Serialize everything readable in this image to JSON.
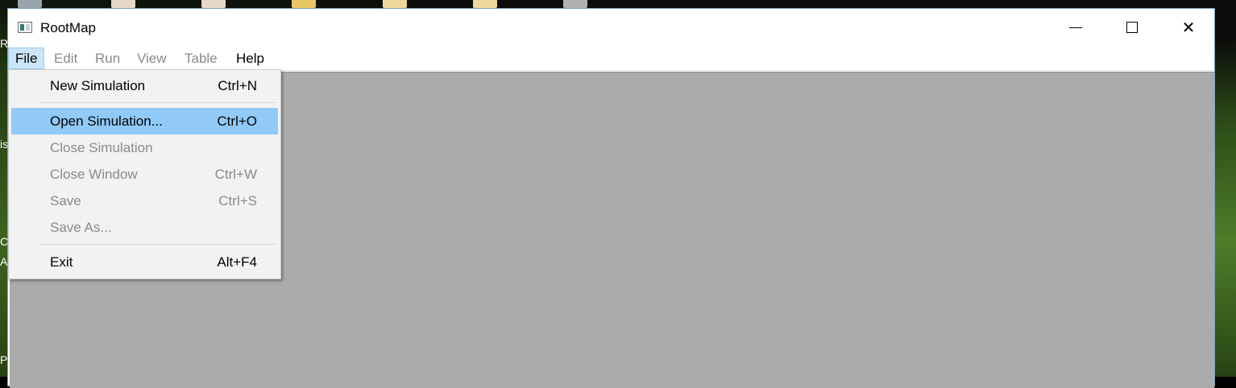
{
  "desktop": {
    "side_text": [
      "R",
      "is",
      "C",
      "A",
      "P"
    ]
  },
  "window": {
    "title": "RootMap",
    "controls": {
      "minimize": "minimize-icon",
      "maximize": "maximize-icon",
      "close": "close-icon",
      "close_glyph": "✕"
    }
  },
  "menubar": {
    "items": [
      {
        "label": "File",
        "state": "active"
      },
      {
        "label": "Edit",
        "state": "disabled"
      },
      {
        "label": "Run",
        "state": "disabled"
      },
      {
        "label": "View",
        "state": "disabled"
      },
      {
        "label": "Table",
        "state": "disabled"
      },
      {
        "label": "Help",
        "state": "enabled"
      }
    ]
  },
  "file_menu": {
    "items": [
      {
        "label": "New Simulation",
        "shortcut": "Ctrl+N",
        "state": "enabled"
      },
      {
        "label": "Open Simulation...",
        "shortcut": "Ctrl+O",
        "state": "highlighted"
      },
      {
        "label": "Close Simulation",
        "shortcut": "",
        "state": "disabled"
      },
      {
        "label": "Close Window",
        "shortcut": "Ctrl+W",
        "state": "disabled"
      },
      {
        "label": "Save",
        "shortcut": "Ctrl+S",
        "state": "disabled"
      },
      {
        "label": "Save As...",
        "shortcut": "",
        "state": "disabled"
      },
      {
        "label": "Exit",
        "shortcut": "Alt+F4",
        "state": "enabled"
      }
    ]
  },
  "colors": {
    "menu_highlight": "#91c9f7",
    "active_menu_bg": "#cce4f7",
    "client_area": "#ababab",
    "disabled_text": "#8a8a8a"
  }
}
